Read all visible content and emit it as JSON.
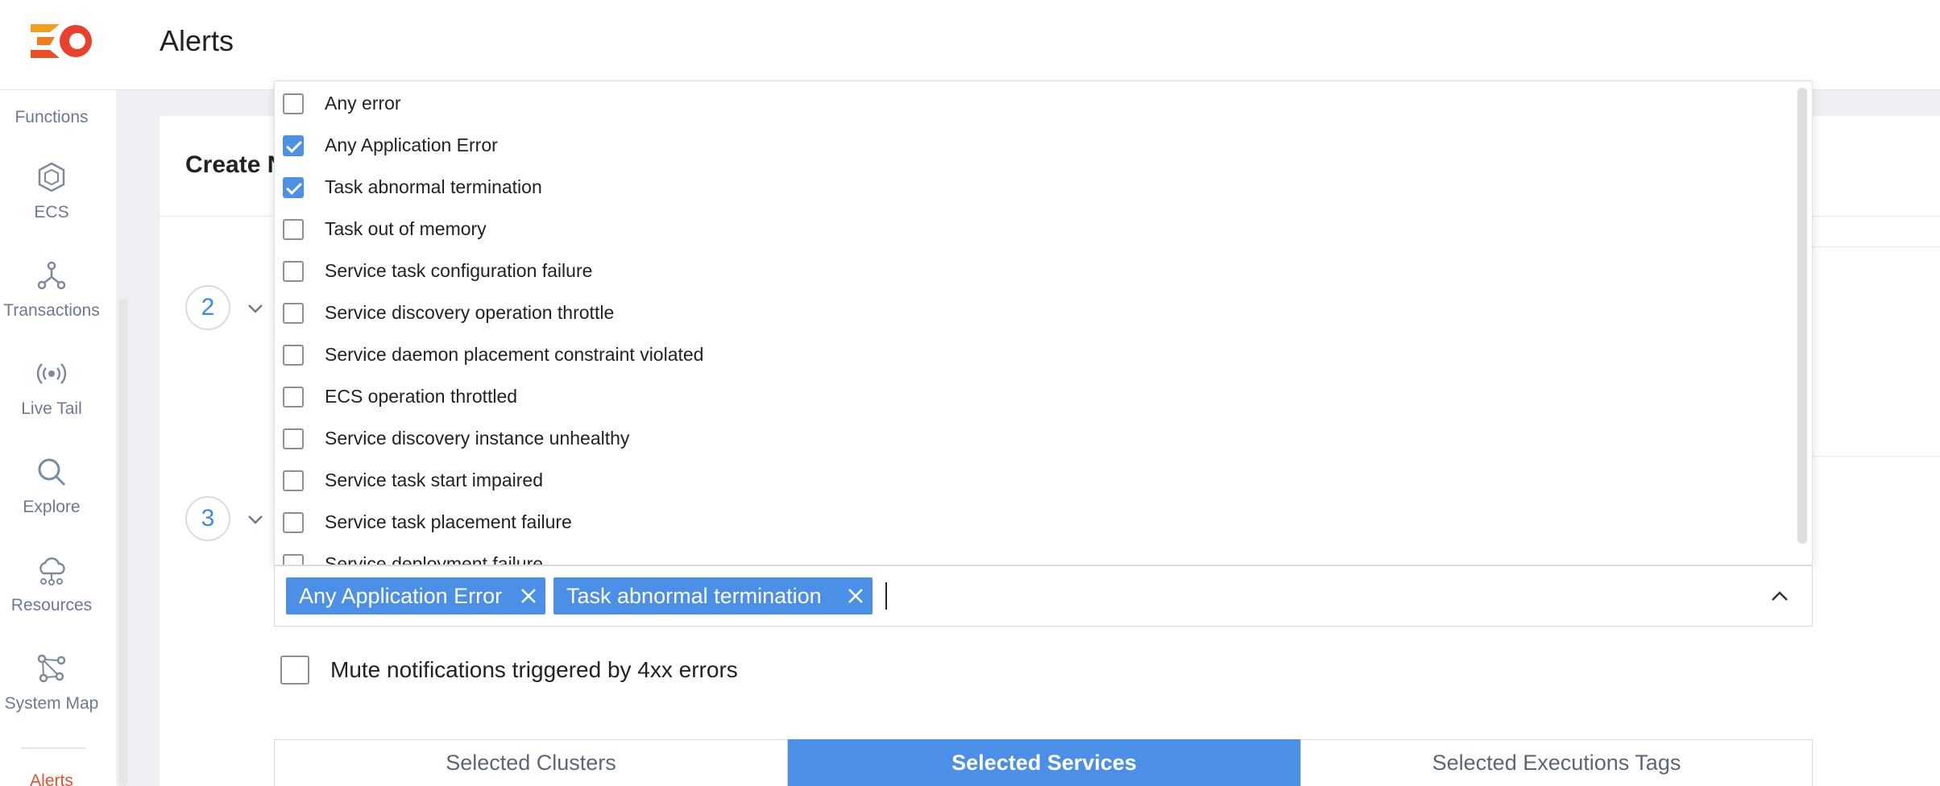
{
  "header": {
    "title": "Alerts",
    "logo": "app-logo"
  },
  "sidebar": {
    "items": [
      {
        "label": "Functions",
        "icon": "functions-icon"
      },
      {
        "label": "ECS",
        "icon": "hexagon-icon"
      },
      {
        "label": "Transactions",
        "icon": "transactions-icon"
      },
      {
        "label": "Live Tail",
        "icon": "broadcast-icon"
      },
      {
        "label": "Explore",
        "icon": "search-icon"
      },
      {
        "label": "Resources",
        "icon": "cloud-network-icon"
      },
      {
        "label": "System Map",
        "icon": "system-map-icon"
      },
      {
        "label": "Alerts",
        "icon": "alerts-icon"
      }
    ],
    "active": "Alerts"
  },
  "main": {
    "title": "Create N",
    "steps": [
      "2",
      "3"
    ]
  },
  "dropdown": {
    "options": [
      {
        "label": "Any error",
        "checked": false
      },
      {
        "label": "Any Application Error",
        "checked": true
      },
      {
        "label": "Task abnormal termination",
        "checked": true
      },
      {
        "label": "Task out of memory",
        "checked": false
      },
      {
        "label": "Service task configuration failure",
        "checked": false
      },
      {
        "label": "Service discovery operation throttle",
        "checked": false
      },
      {
        "label": "Service daemon placement constraint violated",
        "checked": false
      },
      {
        "label": "ECS operation throttled",
        "checked": false
      },
      {
        "label": "Service discovery instance unhealthy",
        "checked": false
      },
      {
        "label": "Service task start impaired",
        "checked": false
      },
      {
        "label": "Service task placement failure",
        "checked": false
      },
      {
        "label": "Service deployment failure",
        "checked": false
      }
    ]
  },
  "multiselect": {
    "chips": [
      "Any Application Error",
      "Task abnormal termination"
    ]
  },
  "mute": {
    "label": "Mute notifications triggered by 4xx errors",
    "checked": false
  },
  "tabs": [
    {
      "label": "Selected Clusters",
      "active": false
    },
    {
      "label": "Selected Services",
      "active": true
    },
    {
      "label": "Selected Executions Tags",
      "active": false
    }
  ],
  "colors": {
    "accent": "#4c8fe6",
    "brand": "#e8502c",
    "sidebar_text": "#6b7a90"
  }
}
